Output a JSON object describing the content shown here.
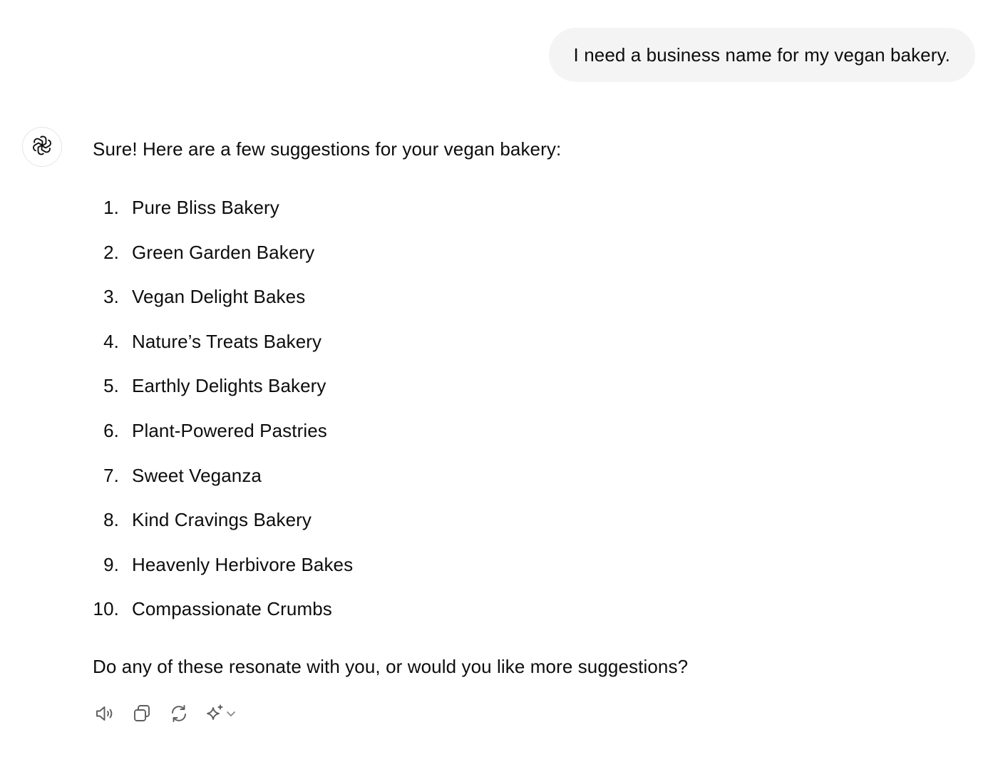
{
  "user_message": {
    "text": "I need a business name for my vegan bakery."
  },
  "assistant": {
    "avatar_icon": "openai-logo-icon",
    "intro": "Sure! Here are a few suggestions for your vegan bakery:",
    "suggestions": [
      {
        "num": "1.",
        "text": "Pure Bliss Bakery"
      },
      {
        "num": "2.",
        "text": "Green Garden Bakery"
      },
      {
        "num": "3.",
        "text": "Vegan Delight Bakes"
      },
      {
        "num": "4.",
        "text": "Nature’s Treats Bakery"
      },
      {
        "num": "5.",
        "text": "Earthly Delights Bakery"
      },
      {
        "num": "6.",
        "text": "Plant-Powered Pastries"
      },
      {
        "num": "7.",
        "text": "Sweet Veganza"
      },
      {
        "num": "8.",
        "text": "Kind Cravings Bakery"
      },
      {
        "num": "9.",
        "text": "Heavenly Herbivore Bakes"
      },
      {
        "num": "10.",
        "text": "Compassionate Crumbs"
      }
    ],
    "outro": "Do any of these resonate with you, or would you like more suggestions?"
  },
  "actions": {
    "icons": [
      "speaker-icon",
      "copy-icon",
      "regenerate-icon",
      "sparkle-icon",
      "chevron-down-icon"
    ]
  },
  "colors": {
    "bubble_bg": "#f4f4f4",
    "text": "#0d0d0d",
    "icon": "#5d5d5d"
  }
}
